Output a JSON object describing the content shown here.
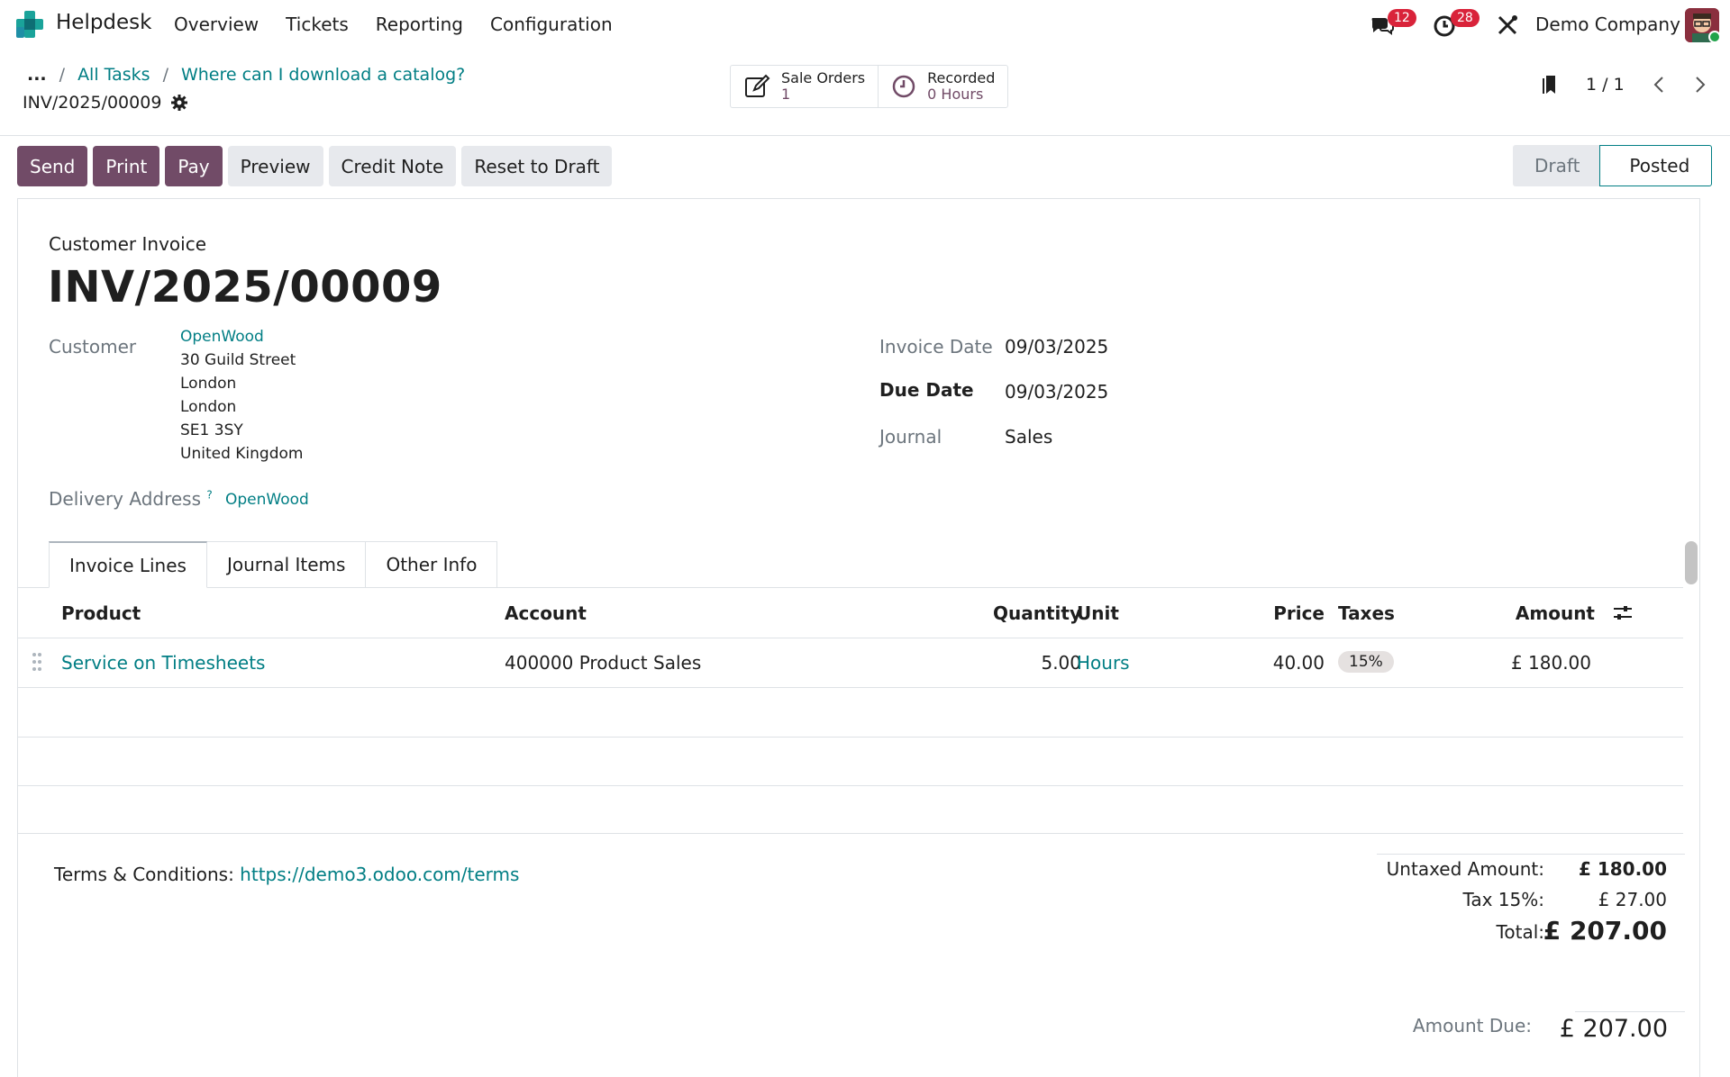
{
  "nav": {
    "app_name": "Helpdesk",
    "menu": [
      "Overview",
      "Tickets",
      "Reporting",
      "Configuration"
    ],
    "chat_badge": "12",
    "activity_badge": "28",
    "company": "Demo Company"
  },
  "breadcrumb": {
    "ellipsis": "...",
    "items": [
      "All Tasks",
      "Where can I download a catalog?"
    ],
    "separator": "/",
    "record": "INV/2025/00009"
  },
  "smart_buttons": [
    {
      "label": "Sale Orders",
      "value": "1",
      "icon": "edit-icon"
    },
    {
      "label": "Recorded",
      "value": "0 Hours",
      "icon": "clock-icon"
    }
  ],
  "pager": {
    "text": "1 / 1"
  },
  "actions": {
    "send": "Send",
    "print": "Print",
    "pay": "Pay",
    "preview": "Preview",
    "credit_note": "Credit Note",
    "reset": "Reset to Draft"
  },
  "status": {
    "draft": "Draft",
    "posted": "Posted"
  },
  "invoice": {
    "type_label": "Customer Invoice",
    "number": "INV/2025/00009",
    "customer_label": "Customer",
    "customer_name": "OpenWood",
    "address": [
      "30 Guild Street",
      "London",
      "London",
      "SE1 3SY",
      "United Kingdom"
    ],
    "delivery_label": "Delivery Address",
    "delivery_help": "?",
    "delivery_value": "OpenWood",
    "invoice_date_label": "Invoice Date",
    "invoice_date": "09/03/2025",
    "due_date_label": "Due Date",
    "due_date": "09/03/2025",
    "journal_label": "Journal",
    "journal": "Sales"
  },
  "tabs": [
    "Invoice Lines",
    "Journal Items",
    "Other Info"
  ],
  "table": {
    "headers": {
      "product": "Product",
      "account": "Account",
      "quantity": "Quantity",
      "unit": "Unit",
      "price": "Price",
      "taxes": "Taxes",
      "amount": "Amount"
    },
    "rows": [
      {
        "product": "Service on Timesheets",
        "account": "400000 Product Sales",
        "quantity": "5.00",
        "unit": "Hours",
        "price": "40.00",
        "taxes": "15%",
        "amount": "£ 180.00"
      }
    ]
  },
  "footer": {
    "terms_label": "Terms & Conditions:",
    "terms_link": "https://demo3.odoo.com/terms",
    "untaxed_label": "Untaxed Amount:",
    "untaxed": "£ 180.00",
    "tax_label": "Tax 15%:",
    "tax": "£ 27.00",
    "total_label": "Total:",
    "total": "£ 207.00",
    "due_label": "Amount Due:",
    "due": "£ 207.00"
  },
  "colors": {
    "primary": "#714b67",
    "link": "#017e84",
    "badge": "#d9233a"
  }
}
